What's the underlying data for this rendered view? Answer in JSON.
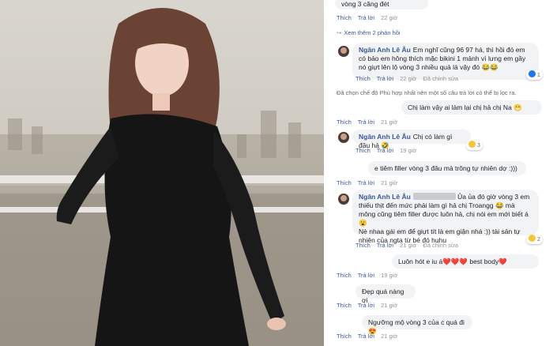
{
  "comments": [
    {
      "text": "vòng 3 căng đét",
      "actions": [
        "Thích",
        "Trả lời"
      ],
      "time": "22 giờ"
    },
    {
      "text": "Xem thêm 2 phản hồi"
    },
    {
      "author": "Ngân Anh Lê Âu",
      "text": "Em nghĩ cũng 96 97 há, thì hồi đó em có bảo em hông thích mặc bikini 1 mảnh vì lưng em gầy nó giựt lên lộ vòng 3 nhiều quá là vậy đó 😂😂",
      "actions": [
        "Thích",
        "Trả lời"
      ],
      "time": "22 giờ",
      "edited": "Đã chỉnh sửa",
      "reaction_count": "1"
    },
    {
      "text": "Đã chọn chế độ Phù hợp nhất nên một số câu trả lời có thể bị lọc ra."
    },
    {
      "text": "Chị làm vậy ai làm lại chị hả chị Na 😁",
      "actions": [
        "Thích",
        "Trả lời"
      ],
      "time": "21 giờ"
    },
    {
      "author": "Ngân Anh Lê Âu",
      "text": "Chị có làm gì đâu hả 🤣",
      "actions": [
        "Thích",
        "Trả lời"
      ],
      "time": "19 giờ",
      "reaction_count": "3"
    },
    {
      "text": "e tiêm filler vòng 3 đâu mà trông tự nhiên dợ :)))",
      "actions": [
        "Thích",
        "Trả lời"
      ],
      "time": "21 giờ"
    },
    {
      "author": "Ngân Anh Lê Âu",
      "text_1": "Ủa ủa đó giờ vòng 3 em thiếu thịt đến mức phải làm gì hả chị Troangg 😂 mà mông cũng tiêm filler được luôn hả, chị nói em mới biết á 😮",
      "text_2": "Nè nhaa gái em để giựt tít là em giận nhá :)) tài sản tự nhiên của ngta từ bé đó huhu",
      "actions": [
        "Thích",
        "Trả lời"
      ],
      "time": "21 giờ",
      "edited": "Đã chỉnh sửa",
      "reaction_count": "2"
    },
    {
      "text": "Luôn hót e iu á❤️❤️❤️ best body❤️",
      "actions": [
        "Thích",
        "Trả lời"
      ],
      "time": "19 giờ"
    },
    {
      "text": "Đẹp quá nàng ơi",
      "actions": [
        "Thích",
        "Trả lời"
      ],
      "time": "21 giờ"
    },
    {
      "text": "Ngưỡng mộ vòng 3 của c quá đi 😍",
      "actions": [
        "Thích",
        "Trả lời"
      ],
      "time": "21 giờ"
    }
  ],
  "colors": {
    "link": "#385898",
    "bubble": "#f2f3f5",
    "meta": "#90949c"
  }
}
